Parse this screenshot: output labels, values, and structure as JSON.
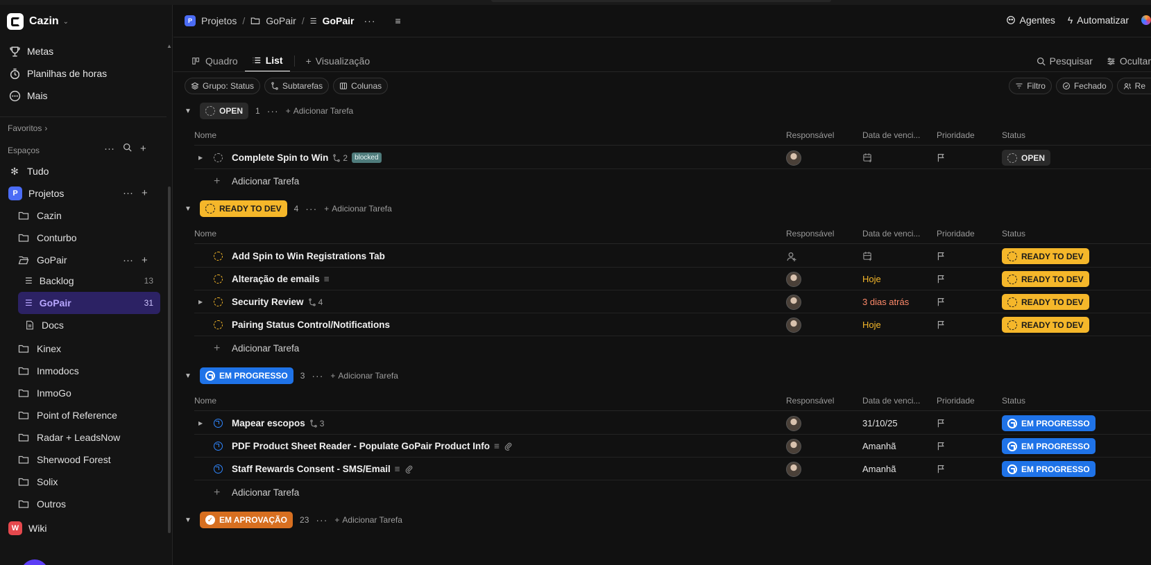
{
  "workspace": {
    "name": "Cazin"
  },
  "sidebar": {
    "nav": [
      {
        "label": "Metas",
        "icon": "trophy-icon"
      },
      {
        "label": "Planilhas de horas",
        "icon": "timesheet-icon"
      },
      {
        "label": "Mais",
        "icon": "more-circle-icon"
      }
    ],
    "favorites_label": "Favoritos",
    "spaces_label": "Espaços",
    "all_label": "Tudo",
    "space": {
      "badge": "P",
      "name": "Projetos"
    },
    "folders_top": [
      "Cazin",
      "Conturbo"
    ],
    "gopair": {
      "name": "GoPair",
      "lists": [
        {
          "label": "Backlog",
          "count": "13"
        },
        {
          "label": "GoPair",
          "count": "31"
        }
      ],
      "docs": "Docs"
    },
    "folders_bottom": [
      "Kinex",
      "Inmodocs",
      "InmoGo",
      "Point of Reference",
      "Radar + LeadsNow",
      "Sherwood Forest",
      "Solix",
      "Outros"
    ],
    "wiki": {
      "badge": "W",
      "name": "Wiki"
    }
  },
  "breadcrumb": {
    "space_badge": "P",
    "space": "Projetos",
    "folder": "GoPair",
    "list": "GoPair"
  },
  "header_actions": {
    "agents": "Agentes",
    "automate": "Automatizar"
  },
  "tabs": {
    "board": "Quadro",
    "list": "List",
    "view": "Visualização"
  },
  "view_actions": {
    "search": "Pesquisar",
    "hide": "Ocultar"
  },
  "chips": {
    "group": "Grupo: Status",
    "subtasks": "Subtarefas",
    "columns": "Colunas"
  },
  "chips_right": {
    "filter": "Filtro",
    "closed": "Fechado",
    "assignee": "Re"
  },
  "columns": {
    "name": "Nome",
    "assignee": "Responsável",
    "due": "Data de venci...",
    "priority": "Prioridade",
    "status": "Status"
  },
  "add_task": "Adicionar Tarefa",
  "groups": [
    {
      "status": "OPEN",
      "count": "1",
      "color": "#2a2a2a",
      "tasks": [
        {
          "name": "Complete Spin to Win",
          "subtasks": "2",
          "tag": "blocked",
          "due": "",
          "status": "OPEN"
        }
      ]
    },
    {
      "status": "READY TO DEV",
      "count": "4",
      "color": "#f5b72a",
      "tasks": [
        {
          "name": "Add Spin to Win Registrations Tab",
          "due": "",
          "status": "READY TO DEV"
        },
        {
          "name": "Alteração de emails",
          "due": "Hoje",
          "status": "READY TO DEV"
        },
        {
          "name": "Security Review",
          "subtasks": "4",
          "due": "3 dias atrás",
          "status": "READY TO DEV"
        },
        {
          "name": "Pairing Status Control/Notifications",
          "due": "Hoje",
          "status": "READY TO DEV"
        }
      ]
    },
    {
      "status": "EM PROGRESSO",
      "count": "3",
      "color": "#1f73e8",
      "tasks": [
        {
          "name": "Mapear escopos",
          "subtasks": "3",
          "due": "31/10/25",
          "status": "EM PROGRESSO"
        },
        {
          "name": "PDF Product Sheet Reader - Populate GoPair Product Info",
          "due": "Amanhã",
          "status": "EM PROGRESSO"
        },
        {
          "name": "Staff Rewards Consent - SMS/Email",
          "due": "Amanhã",
          "status": "EM PROGRESSO"
        }
      ]
    },
    {
      "status": "EM APROVAÇÃO",
      "count": "23",
      "color": "#d76f20",
      "tasks": []
    }
  ]
}
